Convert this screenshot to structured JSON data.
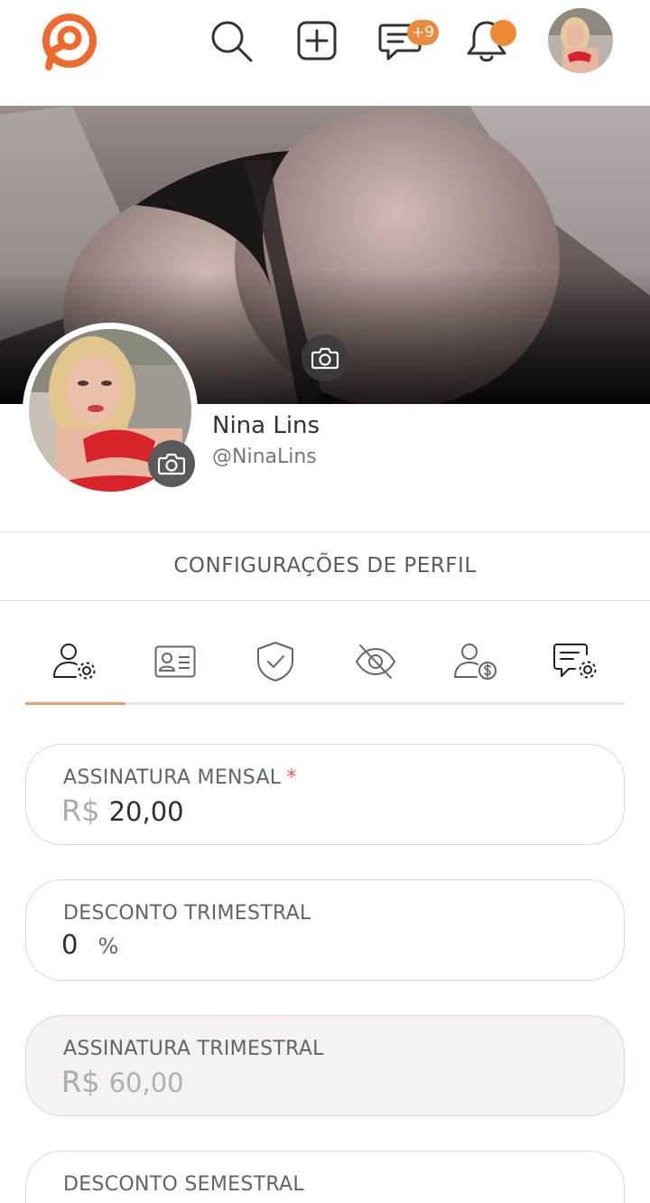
{
  "header": {
    "icons": [
      "logo-icon",
      "search-icon",
      "add-icon",
      "messages-icon",
      "bell-icon"
    ],
    "messages_badge": "+9",
    "accent_color": "#ec8a3d"
  },
  "profile": {
    "name": "Nina Lins",
    "handle": "@NinaLins"
  },
  "settings": {
    "title": "CONFIGURAÇÕES DE PERFIL",
    "tabs": [
      {
        "icon": "user-settings-icon",
        "active": true
      },
      {
        "icon": "id-card-icon",
        "active": false
      },
      {
        "icon": "shield-check-icon",
        "active": false
      },
      {
        "icon": "eye-off-icon",
        "active": false
      },
      {
        "icon": "user-money-icon",
        "active": false
      },
      {
        "icon": "message-settings-icon",
        "active": false
      }
    ]
  },
  "fields": {
    "monthly": {
      "label": "ASSINATURA MENSAL",
      "required_mark": "*",
      "prefix": "R$",
      "value": "20,00"
    },
    "quarterly_discount": {
      "label": "DESCONTO TRIMESTRAL",
      "value": "0",
      "suffix": "%"
    },
    "quarterly": {
      "label": "ASSINATURA TRIMESTRAL",
      "prefix": "R$",
      "value": "60,00"
    },
    "semester_discount": {
      "label": "DESCONTO SEMESTRAL"
    }
  }
}
